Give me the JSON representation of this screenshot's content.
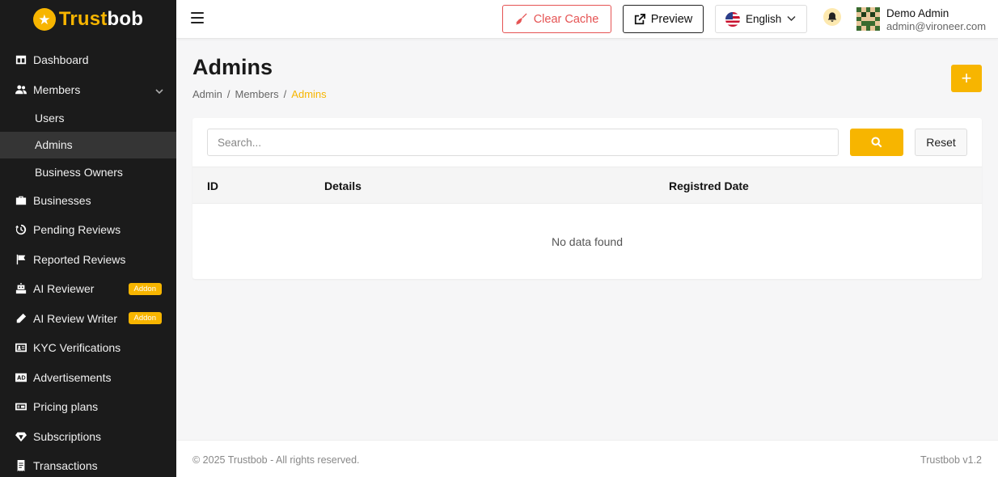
{
  "brand": {
    "name_part1": "Trust",
    "name_part2": "bob",
    "logo_icon": "star-icon",
    "accent_color": "#f7b500"
  },
  "sidebar": {
    "items": [
      {
        "label": "Dashboard",
        "icon": "dashboard-icon"
      },
      {
        "label": "Members",
        "icon": "users-icon",
        "expanded": true,
        "children": [
          {
            "label": "Users"
          },
          {
            "label": "Admins",
            "active": true
          },
          {
            "label": "Business Owners"
          }
        ]
      },
      {
        "label": "Businesses",
        "icon": "briefcase-icon"
      },
      {
        "label": "Pending Reviews",
        "icon": "history-icon"
      },
      {
        "label": "Reported Reviews",
        "icon": "flag-icon"
      },
      {
        "label": "AI Reviewer",
        "icon": "robot-icon",
        "badge": "Addon"
      },
      {
        "label": "AI Review Writer",
        "icon": "pen-icon",
        "badge": "Addon"
      },
      {
        "label": "KYC Verifications",
        "icon": "id-card-icon"
      },
      {
        "label": "Advertisements",
        "icon": "ad-icon"
      },
      {
        "label": "Pricing plans",
        "icon": "pricing-icon"
      },
      {
        "label": "Subscriptions",
        "icon": "gem-icon"
      },
      {
        "label": "Transactions",
        "icon": "receipt-icon"
      }
    ]
  },
  "topbar": {
    "clear_cache_label": "Clear Cache",
    "preview_label": "Preview",
    "language": "English",
    "user": {
      "name": "Demo Admin",
      "email": "admin@viro​neer.com"
    }
  },
  "page": {
    "title": "Admins",
    "breadcrumb": [
      "Admin",
      "Members",
      "Admins"
    ],
    "add_label": "+"
  },
  "table": {
    "search_placeholder": "Search...",
    "reset_label": "Reset",
    "columns": [
      "ID",
      "Details",
      "Registred Date"
    ],
    "empty_message": "No data found"
  },
  "footer": {
    "copyright": "© 2025 Trustbob - All rights reserved.",
    "version": "Trustbob v1.2"
  }
}
